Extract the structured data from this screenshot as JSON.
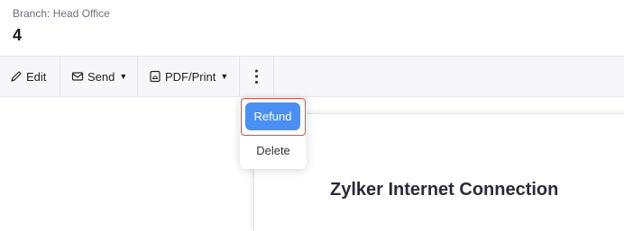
{
  "header": {
    "branch": "Branch: Head Office",
    "record_number": "4"
  },
  "toolbar": {
    "edit_label": "Edit",
    "send_label": "Send",
    "pdf_label": "PDF/Print",
    "more_icon": "⋮"
  },
  "menu": {
    "refund_label": "Refund",
    "delete_label": "Delete"
  },
  "document": {
    "company_name": "Zylker Internet Connection"
  },
  "colors": {
    "accent": "#4a8ff5",
    "highlight_border": "#e2483d"
  }
}
